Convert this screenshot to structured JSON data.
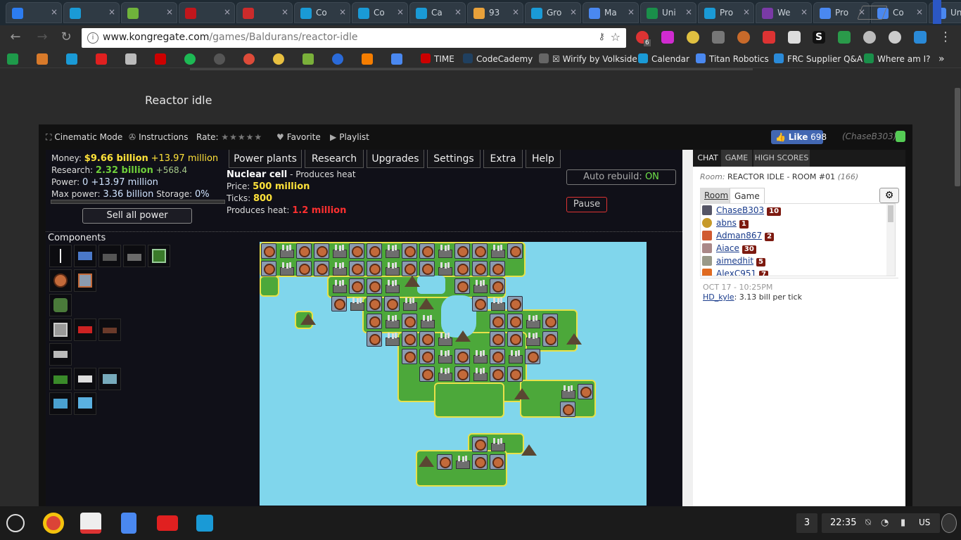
{
  "browser": {
    "tabs": [
      {
        "title": "",
        "color": "#2c7cf0"
      },
      {
        "title": "",
        "color": "#1a9ad6"
      },
      {
        "title": "",
        "color": "#6fb33b"
      },
      {
        "title": "",
        "color": "#c0161c"
      },
      {
        "title": "",
        "color": "#cc2b2b"
      },
      {
        "title": "Co",
        "color": "#1a9ad6"
      },
      {
        "title": "Co",
        "color": "#1a9ad6"
      },
      {
        "title": "Ca",
        "color": "#1a9ad6"
      },
      {
        "title": "93",
        "color": "#e8a13a"
      },
      {
        "title": "Gro",
        "color": "#1a9ad6"
      },
      {
        "title": "Ma",
        "color": "#4a88f0"
      },
      {
        "title": "Uni",
        "color": "#1a8f4a"
      },
      {
        "title": "Pro",
        "color": "#1a9ad6"
      },
      {
        "title": "We",
        "color": "#7a3aa6"
      },
      {
        "title": "Pro",
        "color": "#4a88f0"
      },
      {
        "title": "Co",
        "color": "#4a88f0"
      },
      {
        "title": "Uni",
        "color": "#4a88f0"
      }
    ],
    "url_domain": "www.kongregate.com",
    "url_path": "/games/Baldurans/reactor-idle",
    "extension_badge": "6",
    "bookmarks": [
      {
        "label": "TIME"
      },
      {
        "label": "CodeCademy"
      },
      {
        "label": "☒ Wirify by Volkside"
      },
      {
        "label": "Calendar"
      },
      {
        "label": "Titan Robotics"
      },
      {
        "label": "FRC Supplier Q&A"
      },
      {
        "label": "Where am I?"
      }
    ],
    "bookmark_overflow": "»"
  },
  "page": {
    "game_title": "Reactor idle"
  },
  "game_bar": {
    "cinematic": "Cinematic Mode",
    "instructions": "Instructions",
    "rate_label": "Rate:",
    "stars": "★★★★★",
    "favorite": "Favorite",
    "playlist": "Playlist",
    "like_label": "Like",
    "like_count": "698",
    "username": "(ChaseB303)"
  },
  "game": {
    "money_label": "Money:",
    "money_value": "$9.66 billion",
    "money_rate": "+13.97 million",
    "research_label": "Research:",
    "research_value": "2.32 billion",
    "research_rate": "+568.4",
    "power_label": "Power:",
    "power_value": "0 +13.97 million",
    "maxpower_label": "Max power:",
    "maxpower_value": "3.36 billion",
    "storage_label": "Storage:",
    "storage_value": "0%",
    "sell_button": "Sell all power",
    "menu": [
      "Power plants",
      "Research",
      "Upgrades",
      "Settings",
      "Extra",
      "Help"
    ],
    "selected_name": "Nuclear cell",
    "selected_desc": "- Produces heat",
    "price_label": "Price:",
    "price_value": "500 million",
    "ticks_label": "Ticks:",
    "ticks_value": "800",
    "heat_label": "Produces heat:",
    "heat_value": "1.2 million",
    "auto_rebuild_label": "Auto rebuild:",
    "auto_rebuild_value": "ON",
    "pause_button": "Pause",
    "components_title": "Components"
  },
  "chat": {
    "tabs": [
      "CHAT",
      "GAME",
      "HIGH SCORES"
    ],
    "room_prefix": "Room:",
    "room_name": "REACTOR IDLE - ROOM #01",
    "room_count": "(166)",
    "sub_tabs": [
      "Room",
      "Game"
    ],
    "users": [
      {
        "name": "ChaseB303",
        "level": "10",
        "color": "#556"
      },
      {
        "name": "abns",
        "level": "1",
        "color": "#c79a2a"
      },
      {
        "name": "Adman867",
        "level": "2",
        "color": "#d05a30"
      },
      {
        "name": "Aiace",
        "level": "30",
        "color": "#a88"
      },
      {
        "name": "aimedhit",
        "level": "5",
        "color": "#998"
      },
      {
        "name": "AlexC951",
        "level": "7",
        "color": "#e06a20"
      }
    ],
    "message_time": "OCT 17 - 10:25PM",
    "message_user": "HD_kyle",
    "message_text": ": 3.13 bill per tick"
  },
  "shelf": {
    "notification_count": "3",
    "clock": "22:35",
    "ime": "US"
  }
}
